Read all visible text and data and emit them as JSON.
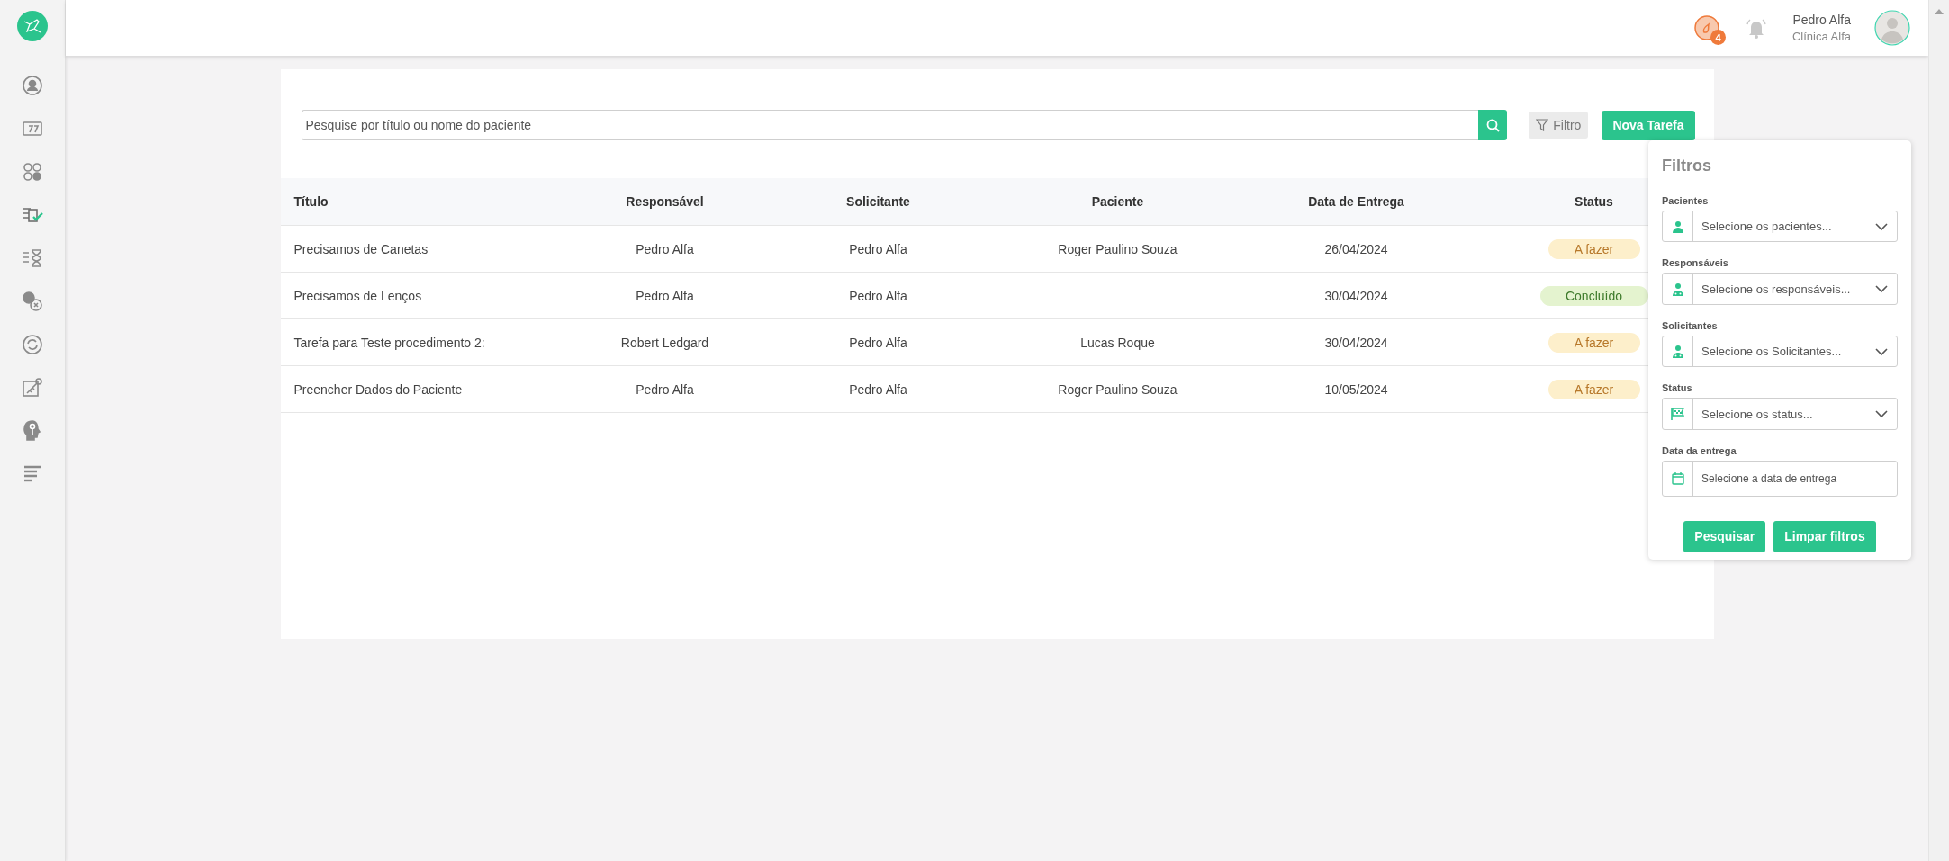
{
  "sidebar": {
    "items": [
      {
        "kind": "user-circle",
        "selected": false
      },
      {
        "kind": "calendar",
        "selected": false
      },
      {
        "kind": "grid",
        "selected": false
      },
      {
        "kind": "task-check",
        "selected": true
      },
      {
        "kind": "hourglass",
        "selected": false
      },
      {
        "kind": "check-x",
        "selected": false
      },
      {
        "kind": "refresh",
        "selected": false
      },
      {
        "kind": "key",
        "selected": false
      },
      {
        "kind": "head-key",
        "selected": false
      },
      {
        "kind": "lines",
        "selected": false
      }
    ]
  },
  "header": {
    "timer_badge": "4",
    "user_name": "Pedro Alfa",
    "clinic": "Clínica Alfa"
  },
  "toolbar": {
    "search": {
      "placeholder": "Pesquise por título ou nome do paciente"
    },
    "filter_button": "Filtro",
    "new_button": "Nova Tarefa"
  },
  "table": {
    "columns": [
      "Título",
      "Responsável",
      "Solicitante",
      "Paciente",
      "Data de Entrega",
      "Status"
    ],
    "rows": [
      {
        "cells": [
          "Precisamos de Canetas",
          "Pedro Alfa",
          "Pedro Alfa",
          "Roger Paulino Souza",
          "26/04/2024"
        ],
        "status": {
          "label": "A fazer",
          "kind": "todo"
        }
      },
      {
        "cells": [
          "Precisamos de Lenços",
          "Pedro Alfa",
          "Pedro Alfa",
          "",
          "30/04/2024"
        ],
        "status": {
          "label": "Concluído",
          "kind": "done"
        }
      },
      {
        "cells": [
          "Tarefa para Teste procedimento 2:",
          "Robert Ledgard",
          "Pedro Alfa",
          "Lucas Roque",
          "30/04/2024"
        ],
        "status": {
          "label": "A fazer",
          "kind": "todo"
        }
      },
      {
        "cells": [
          "Preencher Dados do Paciente",
          "Pedro Alfa",
          "Pedro Alfa",
          "Roger Paulino Souza",
          "10/05/2024"
        ],
        "status": {
          "label": "A fazer",
          "kind": "todo"
        }
      }
    ]
  },
  "filter_panel": {
    "title": "Filtros",
    "fields": [
      {
        "label": "Pacientes",
        "placeholder": "Selecione os pacientes...",
        "kind": "patient"
      },
      {
        "label": "Responsáveis",
        "placeholder": "Selecione os responsáveis...",
        "kind": "staff"
      },
      {
        "label": "Solicitantes",
        "placeholder": "Selecione os Solicitantes...",
        "kind": "staff"
      },
      {
        "label": "Status",
        "placeholder": "Selecione os status...",
        "kind": "status"
      },
      {
        "label": "Data da entrega",
        "placeholder": "Selecione a data de entrega",
        "kind": "date"
      }
    ],
    "buttons": [
      "Pesquisar",
      "Limpar filtros"
    ]
  }
}
